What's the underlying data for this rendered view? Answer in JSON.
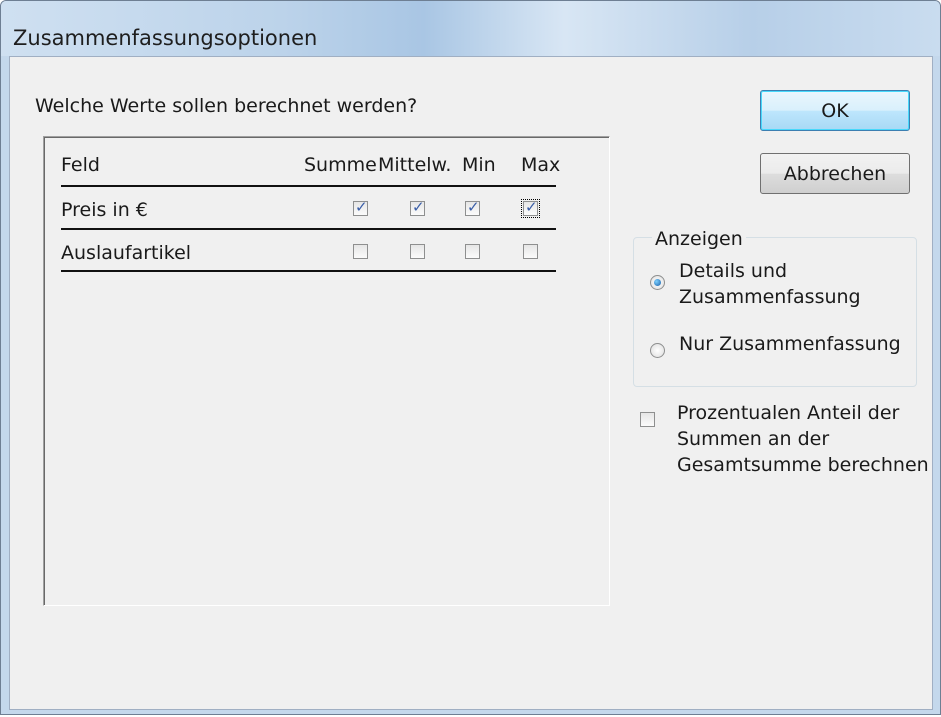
{
  "window": {
    "title": "Zusammenfassungsoptionen"
  },
  "question": "Welche Werte sollen berechnet werden?",
  "table": {
    "headers": {
      "field": "Feld",
      "sum": "Summe",
      "avg": "Mittelw.",
      "min": "Min",
      "max": "Max"
    },
    "rows": [
      {
        "label": "Preis in €",
        "sum": true,
        "avg": true,
        "min": true,
        "max": true
      },
      {
        "label": "Auslaufartikel",
        "sum": false,
        "avg": false,
        "min": false,
        "max": false
      }
    ]
  },
  "buttons": {
    "ok": "OK",
    "cancel": "Abbrechen"
  },
  "display": {
    "legend": "Anzeigen",
    "options": [
      {
        "line1": "Details und",
        "line2": "Zusammenfassung",
        "selected": true
      },
      {
        "line1": "Nur Zusammenfassung",
        "line2": "",
        "selected": false
      }
    ]
  },
  "percent": {
    "line1": "Prozentualen Anteil der",
    "line2": "Summen an der",
    "line3": "Gesamtsumme berechnen",
    "checked": false
  }
}
